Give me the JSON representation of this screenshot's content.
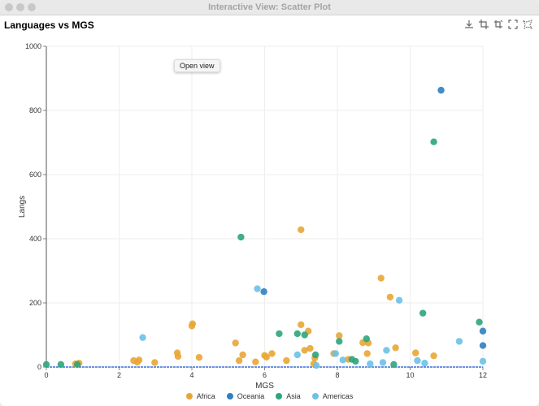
{
  "window": {
    "title": "Interactive View: Scatter Plot"
  },
  "tooltip": {
    "label": "Open view"
  },
  "colors": {
    "Africa": "#e8a635",
    "Oceania": "#2f7fc1",
    "Asia": "#2da57c",
    "Americas": "#6cc1e8"
  },
  "toolbar": [
    "download-icon",
    "crop-icon",
    "crop-reset-icon",
    "expand-icon",
    "lasso-icon"
  ],
  "chart_data": {
    "type": "scatter",
    "title": "Languages vs MGS",
    "xlabel": "MGS",
    "ylabel": "Langs",
    "xlim": [
      0,
      12
    ],
    "ylim": [
      0,
      1000
    ],
    "xticks": [
      0,
      2,
      4,
      6,
      8,
      10,
      12
    ],
    "yticks": [
      0,
      200,
      400,
      600,
      800,
      1000
    ],
    "grid": true,
    "legend_position": "bottom",
    "series": [
      {
        "name": "Africa",
        "points": [
          [
            0.8,
            10
          ],
          [
            0.9,
            12
          ],
          [
            2.4,
            20
          ],
          [
            2.5,
            15
          ],
          [
            2.55,
            22
          ],
          [
            2.98,
            14
          ],
          [
            3.6,
            44
          ],
          [
            3.62,
            33
          ],
          [
            4.0,
            128
          ],
          [
            4.02,
            135
          ],
          [
            4.2,
            30
          ],
          [
            5.2,
            75
          ],
          [
            5.3,
            20
          ],
          [
            5.4,
            38
          ],
          [
            5.75,
            16
          ],
          [
            6.0,
            36
          ],
          [
            6.05,
            31
          ],
          [
            6.2,
            42
          ],
          [
            6.6,
            20
          ],
          [
            7.0,
            428
          ],
          [
            7.0,
            132
          ],
          [
            7.1,
            52
          ],
          [
            7.2,
            112
          ],
          [
            7.25,
            58
          ],
          [
            7.35,
            10
          ],
          [
            7.38,
            28
          ],
          [
            7.9,
            42
          ],
          [
            8.05,
            98
          ],
          [
            8.3,
            24
          ],
          [
            8.7,
            76
          ],
          [
            8.82,
            42
          ],
          [
            8.85,
            75
          ],
          [
            9.2,
            277
          ],
          [
            9.45,
            218
          ],
          [
            9.6,
            60
          ],
          [
            10.15,
            44
          ],
          [
            10.65,
            35
          ]
        ]
      },
      {
        "name": "Oceania",
        "points": [
          [
            10.85,
            863
          ],
          [
            5.98,
            235
          ],
          [
            12.0,
            112
          ],
          [
            12.0,
            67
          ]
        ]
      },
      {
        "name": "Asia",
        "points": [
          [
            0.0,
            8
          ],
          [
            0.4,
            8
          ],
          [
            0.85,
            8
          ],
          [
            5.35,
            405
          ],
          [
            6.4,
            104
          ],
          [
            6.9,
            104
          ],
          [
            7.1,
            100
          ],
          [
            7.4,
            38
          ],
          [
            8.05,
            80
          ],
          [
            8.4,
            24
          ],
          [
            8.5,
            18
          ],
          [
            8.8,
            88
          ],
          [
            9.55,
            8
          ],
          [
            10.35,
            168
          ],
          [
            10.65,
            702
          ],
          [
            11.9,
            140
          ]
        ]
      },
      {
        "name": "Americas",
        "points": [
          [
            2.65,
            92
          ],
          [
            5.8,
            244
          ],
          [
            6.9,
            38
          ],
          [
            7.42,
            5
          ],
          [
            7.95,
            42
          ],
          [
            8.15,
            22
          ],
          [
            8.9,
            10
          ],
          [
            9.25,
            14
          ],
          [
            9.35,
            52
          ],
          [
            9.7,
            208
          ],
          [
            10.2,
            20
          ],
          [
            10.4,
            12
          ],
          [
            11.35,
            80
          ],
          [
            12.0,
            18
          ]
        ]
      }
    ]
  }
}
